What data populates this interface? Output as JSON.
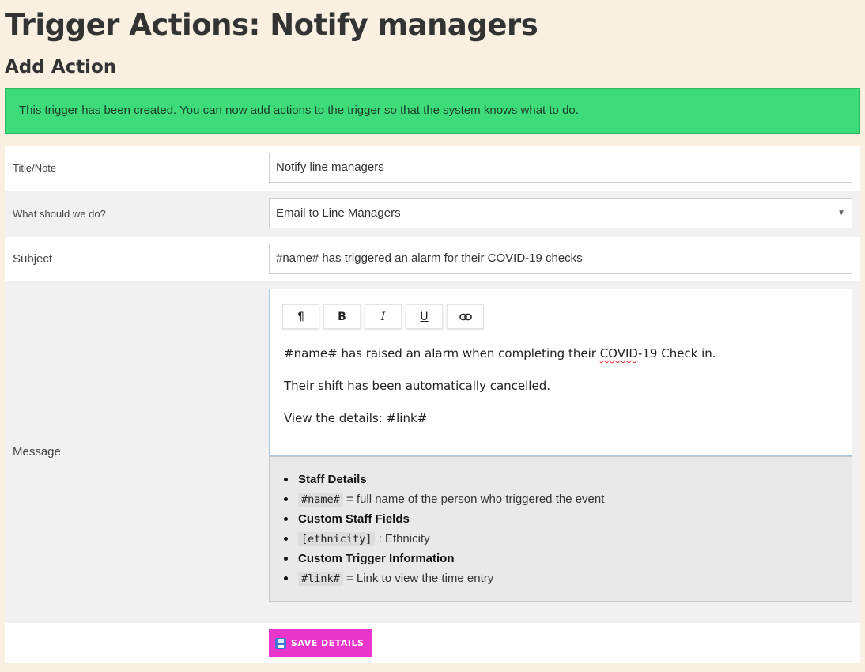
{
  "page_title": "Trigger Actions: Notify managers",
  "section_title": "Add Action",
  "alert_message": "This trigger has been created. You can now add actions to the trigger so that the system knows what to do.",
  "form": {
    "title_label": "Title/Note",
    "title_value": "Notify line managers",
    "action_label": "What should we do?",
    "action_value": "Email to Line Managers",
    "subject_label": "Subject",
    "subject_value": "#name# has triggered an alarm for their COVID-19 checks",
    "message_label": "Message"
  },
  "toolbar": {
    "paragraph": "¶",
    "bold": "B",
    "italic": "I",
    "underline": "U",
    "link_icon": "link-icon"
  },
  "editor": {
    "line1_pre": "#name# has raised an alarm when completing their ",
    "line1_word": "COVID",
    "line1_post": "-19 Check in.",
    "line2": "Their shift has been automatically cancelled.",
    "line3": "View the details: #link#"
  },
  "hints": {
    "staff_heading": "Staff Details",
    "name_code": "#name#",
    "name_desc": " = full name of the person who triggered the event",
    "custom_staff_heading": "Custom Staff Fields",
    "ethnicity_code": "[ethnicity]",
    "ethnicity_desc": " : Ethnicity",
    "custom_trigger_heading": "Custom Trigger Information",
    "link_code": "#link#",
    "link_desc": " = Link to view the time entry"
  },
  "save_label": "SAVE DETAILS",
  "colors": {
    "background": "#faf0e2",
    "alert": "#3ddb7a",
    "save_button": "#e935c9"
  }
}
